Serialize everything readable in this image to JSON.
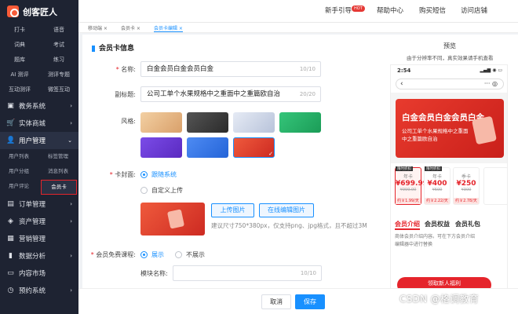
{
  "brand": {
    "name": "创客匠人"
  },
  "sidebar": {
    "quick": [
      "打卡",
      "语音",
      "词典",
      "考试",
      "题库",
      "练习",
      "AI 测评",
      "测评专题",
      "互动测评",
      "微签互动"
    ],
    "groups": [
      {
        "label": "教务系统",
        "icon": "▣"
      },
      {
        "label": "实体商城",
        "icon": "🛒"
      },
      {
        "label": "用户管理",
        "icon": "👤"
      },
      {
        "label": "订单管理",
        "icon": "▤"
      },
      {
        "label": "资产管理",
        "icon": "◈"
      },
      {
        "label": "营销管理",
        "icon": "▦"
      },
      {
        "label": "数据分析",
        "icon": "▮"
      },
      {
        "label": "内容市场",
        "icon": "▭"
      },
      {
        "label": "预约系统",
        "icon": "◷"
      }
    ],
    "user_sub": [
      "用户列表",
      "标签管理",
      "用户分组",
      "消息列表",
      "用户评论",
      "会员卡"
    ]
  },
  "topbar": {
    "guide": "新手引导",
    "hot": "HOT",
    "help": "帮助中心",
    "buy_sms": "购买短信",
    "visit_store": "访问店铺"
  },
  "tabs": [
    "移动端",
    "会员卡",
    "会员卡编辑"
  ],
  "form": {
    "section_title": "会员卡信息",
    "name_label": "名称:",
    "name_value": "白金会员白金会员白金",
    "name_count": "10/10",
    "subtitle_label": "副标题:",
    "subtitle_value": "公司工单个水果规格中之重面中之重篇欧自治",
    "subtitle_count": "20/20",
    "style_label": "风格:",
    "styles": [
      {
        "name": "style-gold",
        "color": "linear-gradient(135deg,#f3d0a3,#d9a06a)"
      },
      {
        "name": "style-black",
        "color": "linear-gradient(135deg,#555,#2a2a2a)"
      },
      {
        "name": "style-silver",
        "color": "linear-gradient(135deg,#e6ebf5,#b8c3da)"
      },
      {
        "name": "style-green",
        "color": "linear-gradient(135deg,#35c57a,#1b9c57)"
      },
      {
        "name": "style-purple",
        "color": "linear-gradient(135deg,#7b4ce8,#5a2ac0)"
      },
      {
        "name": "style-blue",
        "color": "linear-gradient(135deg,#4e8bf3,#2464d8)"
      },
      {
        "name": "style-red",
        "color": "linear-gradient(135deg,#ef5a3c,#cd2a22)"
      }
    ],
    "cover_label": "卡封面:",
    "cover_opt1": "跟随系统",
    "cover_opt2": "自定义上传",
    "upload_button": "上传图片",
    "online_edit_button": "在线编辑图片",
    "cover_hint": "建议尺寸750*380px，仅支持png、jpg格式，且不超过3M",
    "course_label": "会员免费课程:",
    "course_show": "展示",
    "course_hide": "不展示",
    "module_label": "模块名称:",
    "module_count": "10/10"
  },
  "footer": {
    "cancel": "取消",
    "save": "保存"
  },
  "preview": {
    "title": "预览",
    "hint": "由于分辨率不同，真实效果请手机查看",
    "time": "2:54",
    "status": "▂▄▆ ◉ ▭",
    "card_title": "白金会员白金会员白金",
    "card_sub": "公司工单个水果规格中之重面中之重篇欧自治",
    "plans": [
      {
        "tag": "限时折扣",
        "name": "年卡",
        "price": "¥699.99",
        "old": "¥999.00",
        "discount": "约￥1.99/天"
      },
      {
        "tag": "限时折扣",
        "name": "年卡",
        "price": "¥400",
        "old": "¥600",
        "discount": "约￥2.22/天"
      },
      {
        "tag": "",
        "name": "季卡",
        "price": "¥250",
        "old": "¥300",
        "discount": "约￥2.78/天"
      }
    ],
    "tabs": [
      "会员介绍",
      "会员权益",
      "会员礼包"
    ],
    "intro": "商体会员介绍内容。可在下方会员介绍编辑器中进行替换",
    "bottom": "领取新人福利"
  },
  "watermark": "CSDN @格调教育"
}
